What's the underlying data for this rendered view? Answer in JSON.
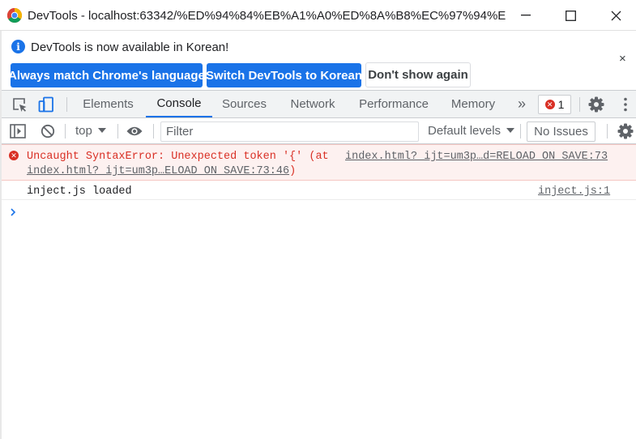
{
  "window": {
    "title": "DevTools - localhost:63342/%ED%94%84%EB%A1%A0%ED%8A%B8%EC%97%94%E..."
  },
  "infobar": {
    "message": "DevTools is now available in Korean!",
    "close_label": "×",
    "buttons": {
      "always_match": "Always match Chrome's language",
      "switch_korean": "Switch DevTools to Korean",
      "dont_show": "Don't show again"
    }
  },
  "tabs": {
    "items": [
      "Elements",
      "Console",
      "Sources",
      "Network",
      "Performance",
      "Memory"
    ],
    "active": "Console",
    "more_label": "»",
    "error_count": "1"
  },
  "console_toolbar": {
    "context": "top",
    "filter_placeholder": "Filter",
    "levels": "Default levels",
    "issues": "No Issues"
  },
  "messages": {
    "error": {
      "text": "Uncaught SyntaxError: Unexpected token '{' (at",
      "source_link": "index.html?_ijt=um3p…d=RELOAD_ON_SAVE:73",
      "location_link": "index.html?_ijt=um3p…ELOAD_ON_SAVE:73:46",
      "location_suffix": ")"
    },
    "log": {
      "text": "inject.js loaded",
      "source_link": "inject.js:1"
    }
  },
  "colors": {
    "accent": "#1a73e8",
    "error": "#d93025",
    "error_bg": "#fdf1f0"
  }
}
